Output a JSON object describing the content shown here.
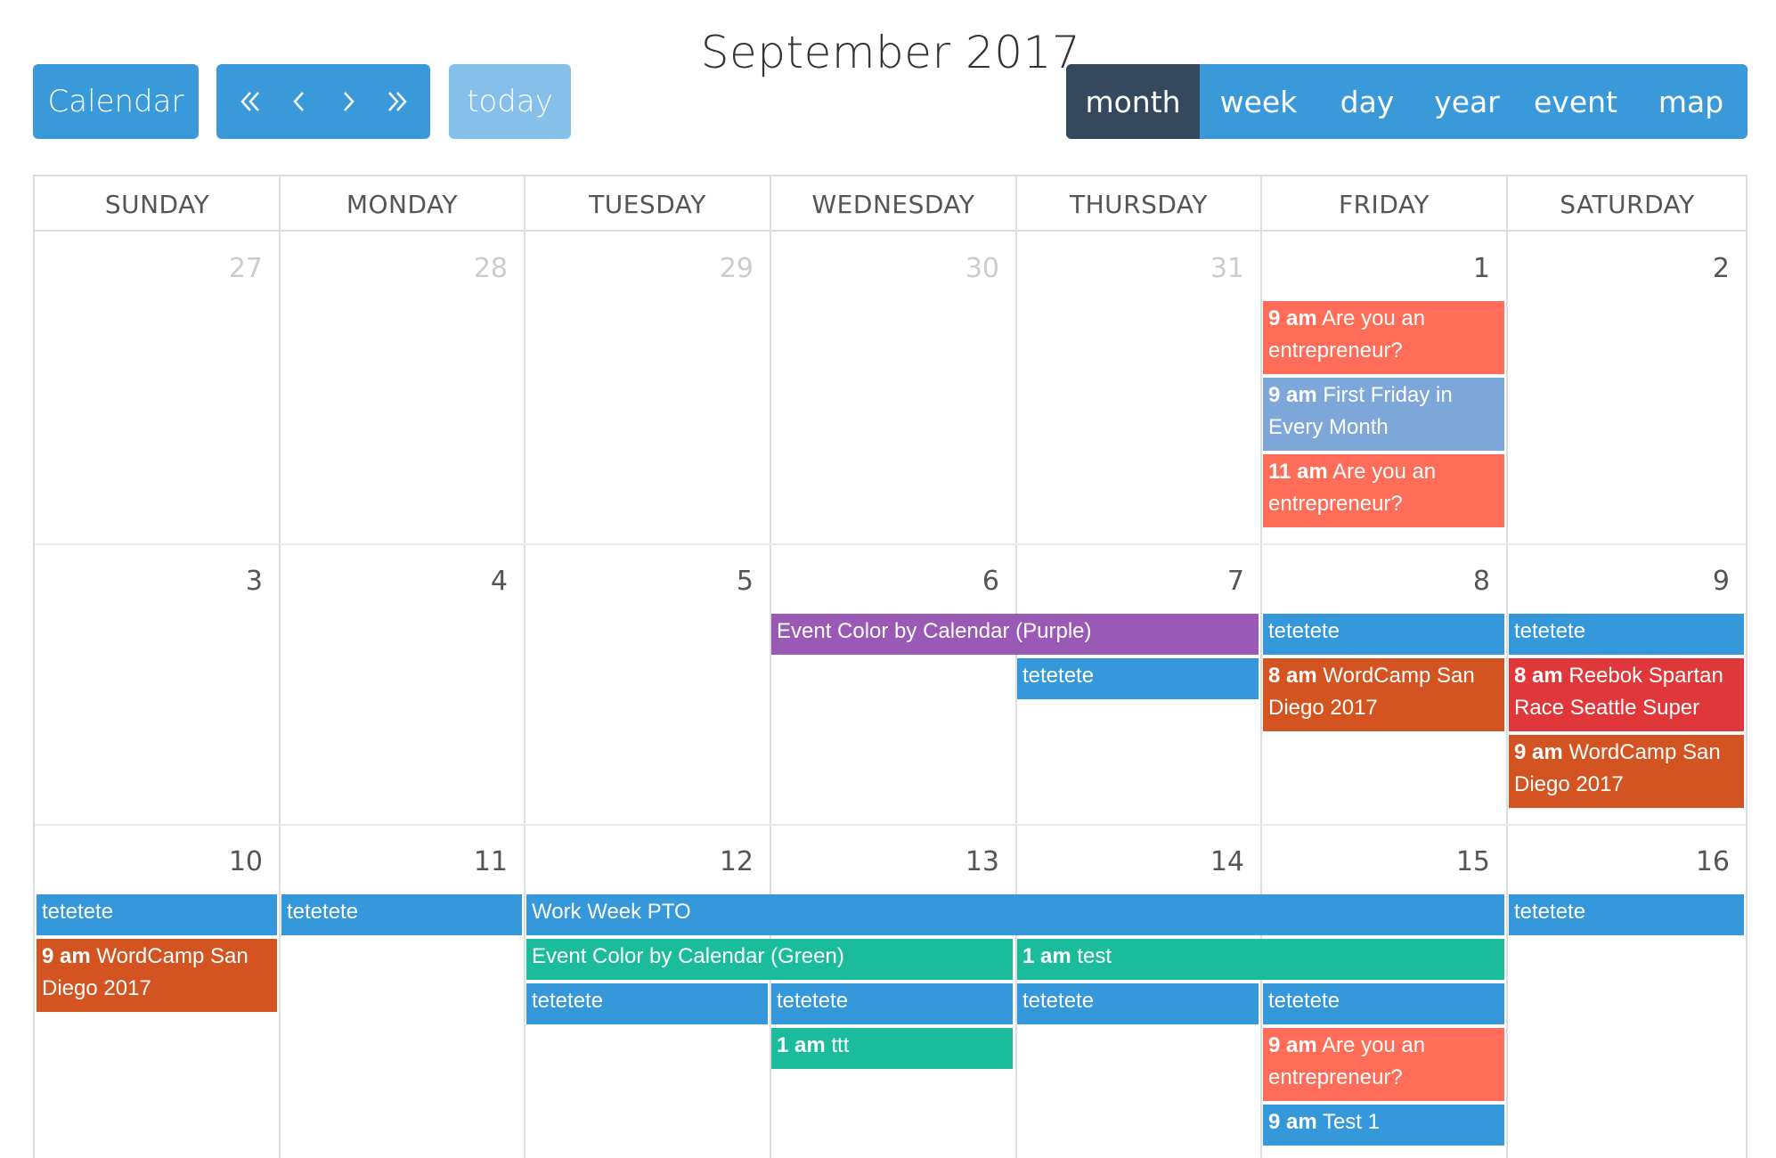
{
  "toolbar": {
    "calendar_label": "Calendar",
    "today_label": "today",
    "title": "September 2017",
    "views": [
      "month",
      "week",
      "day",
      "year",
      "event",
      "map"
    ],
    "active_view": "month"
  },
  "day_headers": [
    "SUNDAY",
    "MONDAY",
    "TUESDAY",
    "WEDNESDAY",
    "THURSDAY",
    "FRIDAY",
    "SATURDAY"
  ],
  "weeks": [
    [
      "27",
      "28",
      "29",
      "30",
      "31",
      "1",
      "2"
    ],
    [
      "3",
      "4",
      "5",
      "6",
      "7",
      "8",
      "9"
    ],
    [
      "10",
      "11",
      "12",
      "13",
      "14",
      "15",
      "16"
    ]
  ],
  "events": {
    "w1": {
      "fri_1": {
        "time": "9 am",
        "title": "Are you an entrepreneur?"
      },
      "fri_2": {
        "time": "9 am",
        "title": "First Friday in Every Month"
      },
      "fri_3": {
        "time": "11 am",
        "title": "Are you an entrepreneur?"
      }
    },
    "w2": {
      "wed_thu": {
        "title": "Event Color by Calendar (Purple)"
      },
      "thu": {
        "title": "tetetete"
      },
      "fri_1": {
        "title": "tetetete"
      },
      "fri_2": {
        "time": "8 am",
        "title": "WordCamp San Diego 2017"
      },
      "sat_1": {
        "title": "tetetete"
      },
      "sat_2": {
        "time": "8 am",
        "title": "Reebok Spartan Race Seattle Super"
      },
      "sat_3": {
        "time": "9 am",
        "title": "WordCamp San Diego 2017"
      }
    },
    "w3": {
      "sun_1": {
        "title": "tetetete"
      },
      "sun_2": {
        "time": "9 am",
        "title": "WordCamp San Diego 2017"
      },
      "mon": {
        "title": "tetetete"
      },
      "pto": {
        "title": "Work Week PTO"
      },
      "sat_1": {
        "title": "tetetete"
      },
      "green": {
        "title": "Event Color by Calendar (Green)"
      },
      "test": {
        "time": "1 am",
        "title": "test"
      },
      "tue": {
        "title": "tetetete"
      },
      "wed": {
        "title": "tetetete"
      },
      "thu": {
        "title": "tetetete"
      },
      "fri": {
        "title": "tetetete"
      },
      "ttt": {
        "time": "1 am",
        "title": "ttt"
      },
      "fri_2": {
        "time": "9 am",
        "title": "Are you an entrepreneur?"
      },
      "fri_3": {
        "time": "9 am",
        "title": "Test 1"
      }
    }
  },
  "colors": {
    "primary": "#3a9ad9",
    "active_tab": "#34495e",
    "today_button": "#86bfea",
    "event_blue": "#3498db",
    "event_coral": "#ff6c57",
    "event_lightblue": "#7ca7d8",
    "event_purple": "#9b59b6",
    "event_orange": "#d35420",
    "event_red": "#e0383a",
    "event_green": "#1abc9c"
  },
  "icons": [
    "double-left-icon",
    "left-icon",
    "right-icon",
    "double-right-icon"
  ]
}
